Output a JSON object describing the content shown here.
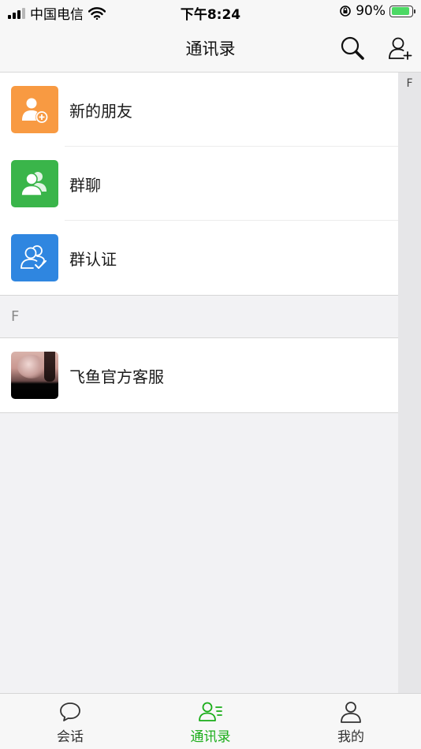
{
  "status_bar": {
    "carrier": "中国电信",
    "time": "下午8:24",
    "battery": "90%",
    "battery_level": 0.9
  },
  "nav": {
    "title": "通讯录",
    "search_icon": "search-icon",
    "add_icon": "add-contact-icon"
  },
  "entries": [
    {
      "label": "新的朋友",
      "icon": "new-friend-icon",
      "color": "#f89a42"
    },
    {
      "label": "群聊",
      "icon": "group-chat-icon",
      "color": "#3ab54a"
    },
    {
      "label": "群认证",
      "icon": "group-verify-icon",
      "color": "#2f86e0"
    }
  ],
  "sections": [
    {
      "letter": "F",
      "contacts": [
        {
          "name": "飞鱼官方客服"
        }
      ]
    }
  ],
  "index_bar": {
    "letters": [
      "F"
    ]
  },
  "tabs": [
    {
      "label": "会话",
      "icon": "chat-bubble-icon",
      "active": false
    },
    {
      "label": "通讯录",
      "icon": "contacts-icon",
      "active": true
    },
    {
      "label": "我的",
      "icon": "person-icon",
      "active": false
    }
  ],
  "colors": {
    "accent": "#1aad19",
    "new_friend": "#f89a42",
    "group_chat": "#3ab54a",
    "group_verify": "#2f86e0"
  }
}
